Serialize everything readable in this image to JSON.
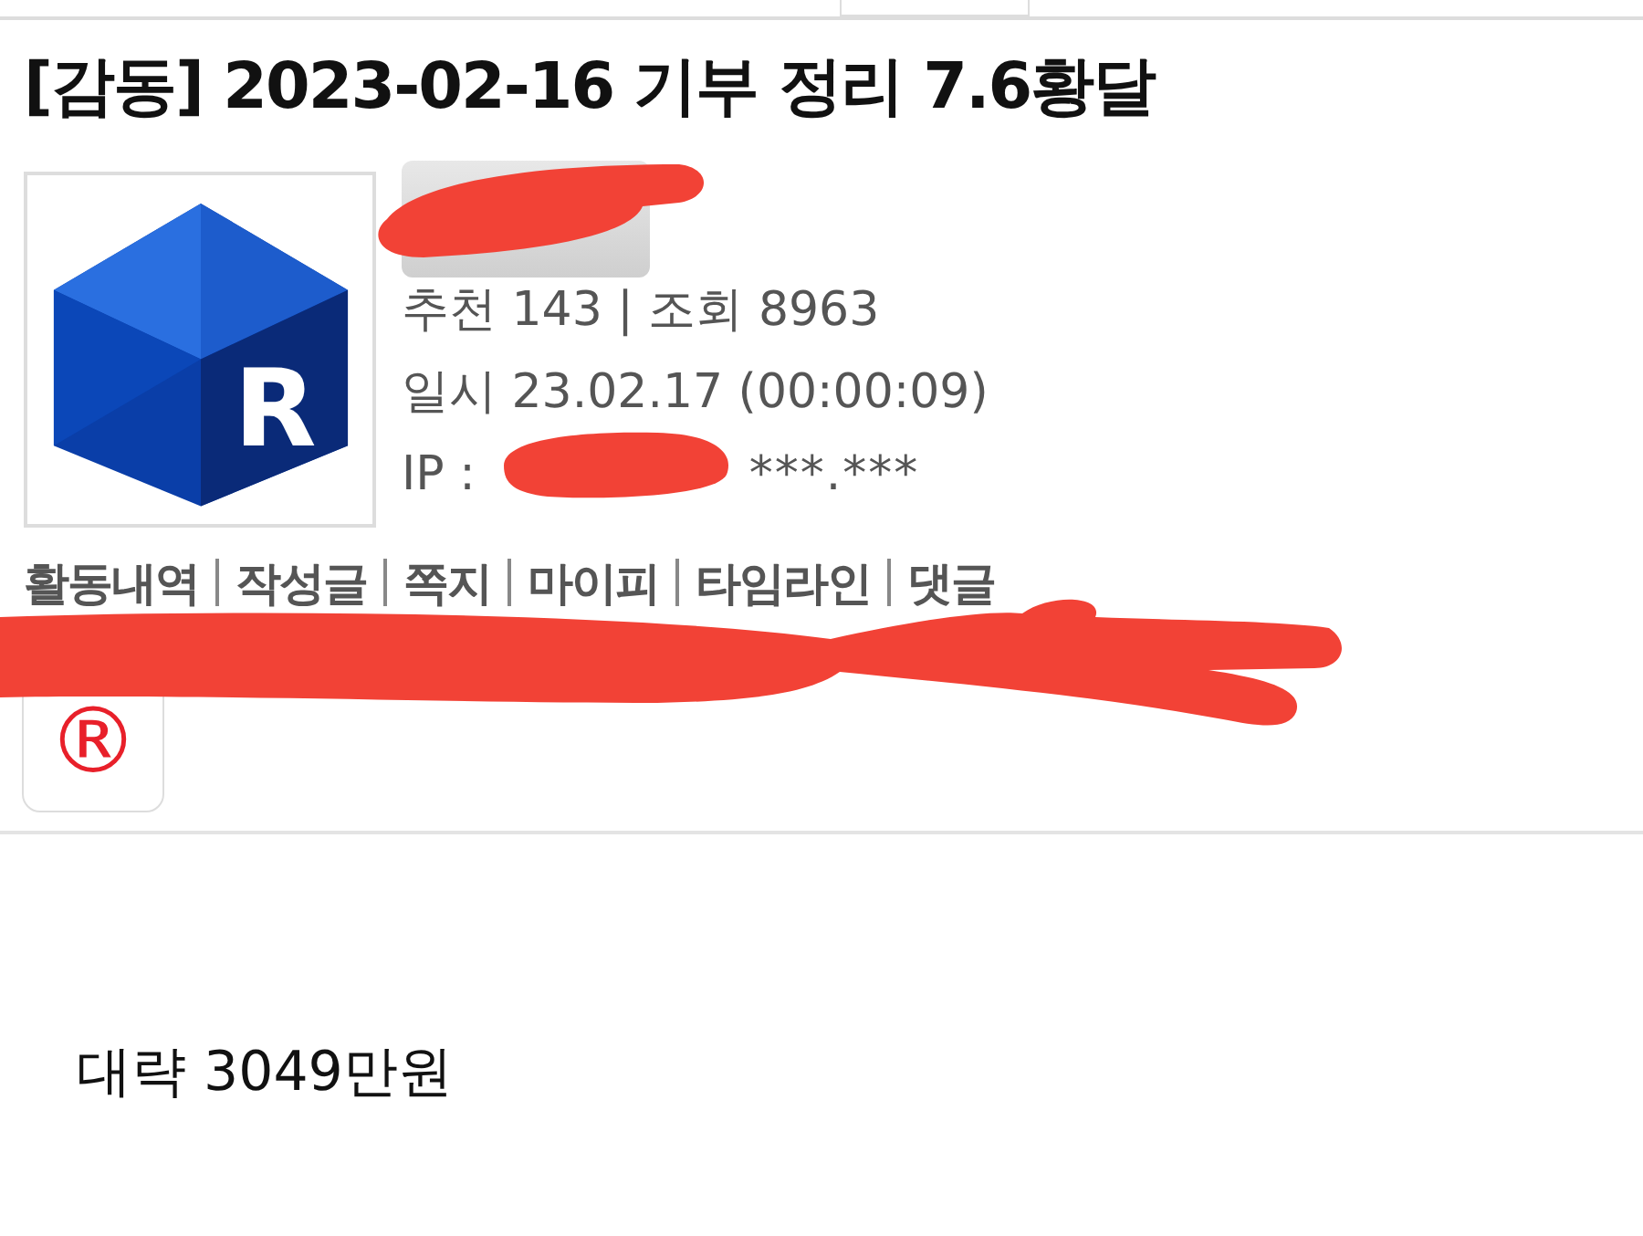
{
  "title": "[감동] 2023-02-16 기부 정리 7.6황달",
  "avatar": {
    "letter": "R"
  },
  "stats": [
    {
      "kind": "text",
      "text": "추천 143 | 조회 8963"
    },
    {
      "kind": "text",
      "text": "일시 23.02.17 (00:00:09)"
    },
    {
      "kind": "ip",
      "label": "IP :",
      "value": "***.***"
    }
  ],
  "links": [
    "활동내역",
    "작성글",
    "쪽지",
    "마이피",
    "타임라인",
    "댓글"
  ],
  "badge": {
    "symbol": "®"
  },
  "body": "대략 3049만원"
}
